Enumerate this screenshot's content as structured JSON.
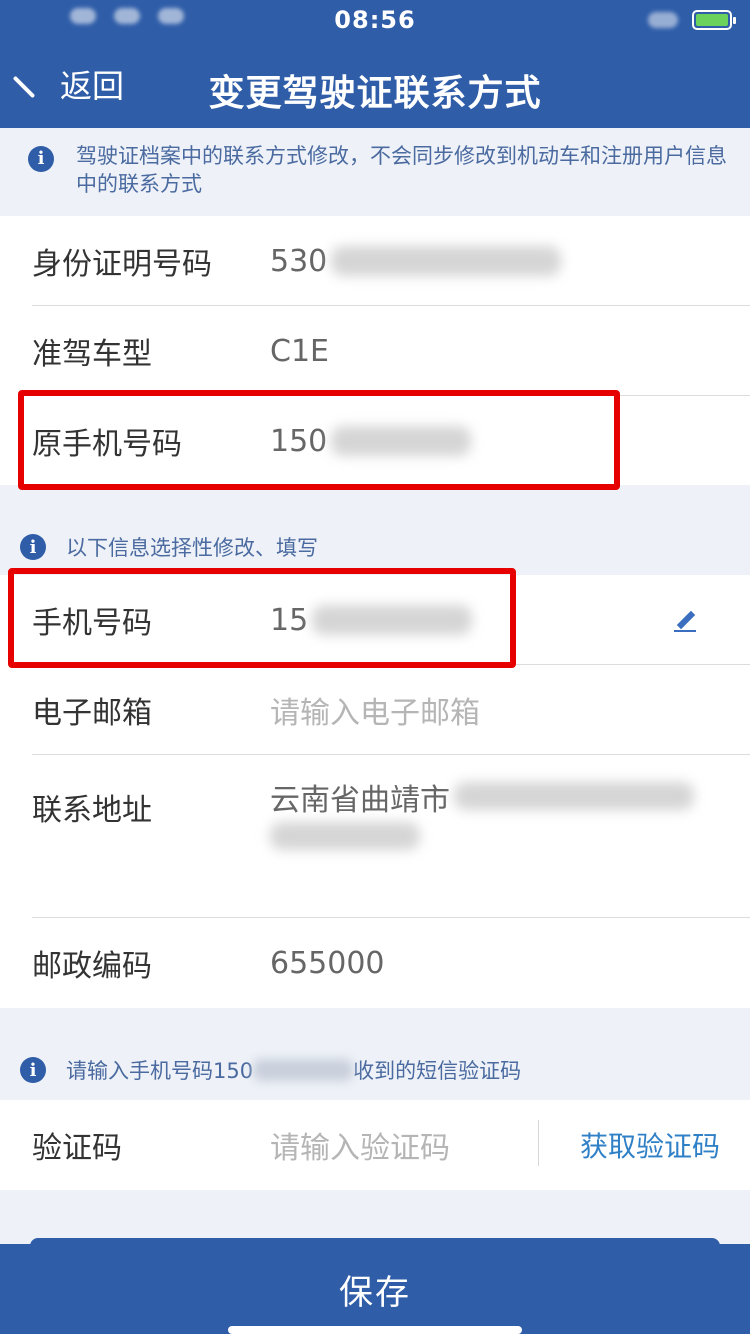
{
  "status": {
    "time": "08:56"
  },
  "nav": {
    "back_label": "返回",
    "title": "变更驾驶证联系方式"
  },
  "notice_top": "驾驶证档案中的联系方式修改，不会同步修改到机动车和注册用户信息中的联系方式",
  "info_rows": [
    {
      "label": "身份证明号码",
      "value": "530"
    },
    {
      "label": "准驾车型",
      "value": "C1E"
    },
    {
      "label": "原手机号码",
      "value": "150"
    }
  ],
  "notice_optional": "以下信息选择性修改、填写",
  "edit_rows": {
    "phone": {
      "label": "手机号码",
      "value": "15"
    },
    "email": {
      "label": "电子邮箱",
      "placeholder": "请输入电子邮箱"
    },
    "address": {
      "label": "联系地址",
      "value": "云南省曲靖市"
    },
    "postcode": {
      "label": "邮政编码",
      "value": "655000"
    }
  },
  "notice_sms": {
    "prefix": "请输入手机号码150",
    "suffix": "收到的短信验证码"
  },
  "verify": {
    "label": "验证码",
    "placeholder": "请输入验证码",
    "get_code": "获取验证码"
  },
  "save_label": "保存"
}
